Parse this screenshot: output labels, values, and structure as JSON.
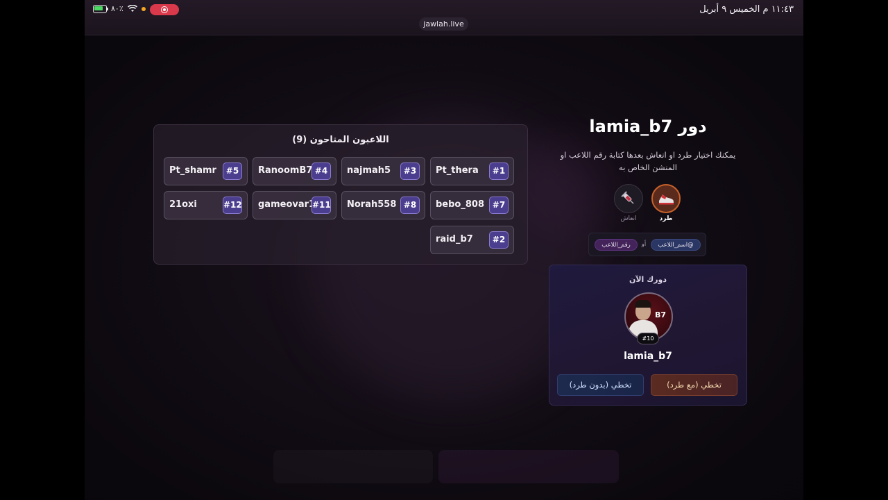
{
  "status_bar": {
    "time_date": "١١:٤٣ م   الخميس ٩ أبريل",
    "battery": "٨٠٪",
    "url": "jawlah.live"
  },
  "players_panel": {
    "title": "اللاعبون المتاحون (9)",
    "players": [
      {
        "name": "Pt_thera",
        "num": "#1"
      },
      {
        "name": "najmah5",
        "num": "#3"
      },
      {
        "name": "RanoomB7",
        "num": "#4"
      },
      {
        "name": "Pt_shamr",
        "num": "#5"
      },
      {
        "name": "bebo_808",
        "num": "#7"
      },
      {
        "name": "Norah558",
        "num": "#8"
      },
      {
        "name": "gameovar12",
        "num": "#11"
      },
      {
        "name": "21oxi",
        "num": "#12"
      },
      {
        "name": "raid_b7",
        "num": "#2"
      }
    ]
  },
  "turn": {
    "title": "دور lamia_b7",
    "description": "يمكنك اختيار طرد او انعاش بعدها كتابة رقم اللاعب او المنشن الخاص به",
    "actions": {
      "kick_label": "طرد",
      "revive_label": "انعاش",
      "kick_icon": "shoe-kick-icon",
      "revive_icon": "syringe-icon"
    },
    "hint": {
      "mention_chip": "@اسم_اللاعب",
      "or_text": "أو",
      "number_chip": "رقم_اللاعب"
    }
  },
  "current_turn_card": {
    "label": "دورك الآن",
    "avatar_logo": "B7",
    "player_number": "#10",
    "player_name": "lamia_b7",
    "skip_with_kick": "تخطي (مع طرد)",
    "skip_without_kick": "تخطي (بدون طرد)"
  }
}
